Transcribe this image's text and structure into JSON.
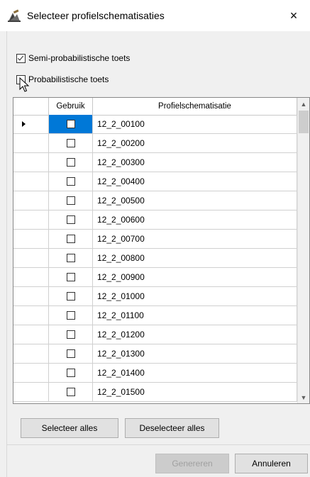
{
  "window": {
    "title": "Selecteer profielschematisaties",
    "close_glyph": "×"
  },
  "options": {
    "semi": {
      "label": "Semi-probabilistische toets",
      "checked": true
    },
    "prob": {
      "label": "Probabilistische toets",
      "checked": false
    }
  },
  "grid": {
    "columns": {
      "gebruik": "Gebruik",
      "profiel": "Profielschematisatie"
    },
    "rows": [
      "12_2_00100",
      "12_2_00200",
      "12_2_00300",
      "12_2_00400",
      "12_2_00500",
      "12_2_00600",
      "12_2_00700",
      "12_2_00800",
      "12_2_00900",
      "12_2_01000",
      "12_2_01100",
      "12_2_01200",
      "12_2_01300",
      "12_2_01400",
      "12_2_01500"
    ],
    "selected_row": 0
  },
  "buttons": {
    "select_all": "Selecteer alles",
    "deselect_all": "Deselecteer alles",
    "generate": "Genereren",
    "cancel": "Annuleren"
  },
  "colors": {
    "selection": "#0078d7"
  }
}
